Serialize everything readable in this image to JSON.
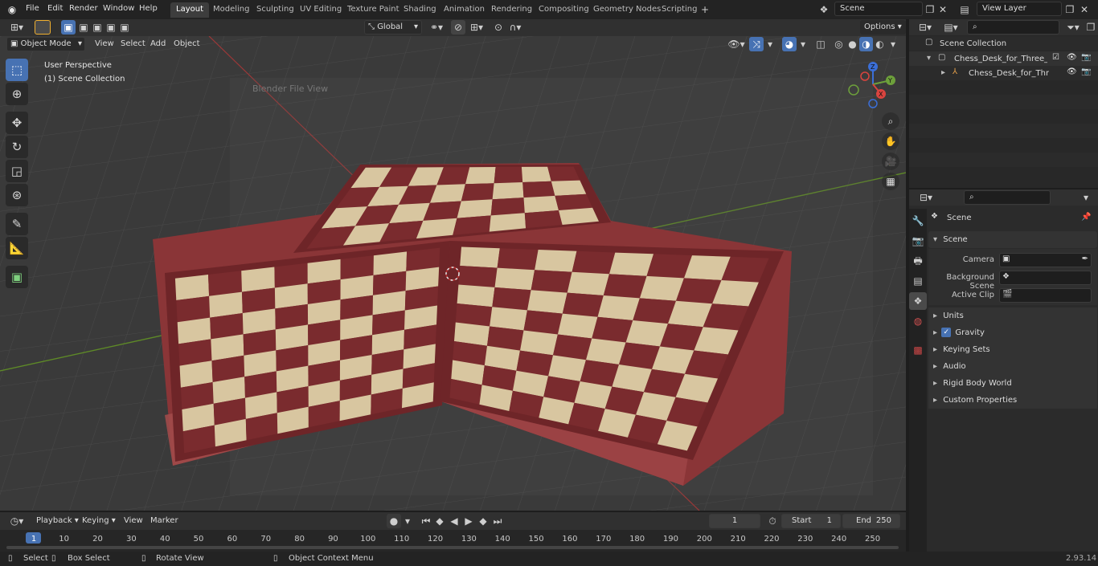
{
  "menu": {
    "file": "File",
    "edit": "Edit",
    "render": "Render",
    "window": "Window",
    "help": "Help"
  },
  "workspaces": [
    "Layout",
    "Modeling",
    "Sculpting",
    "UV Editing",
    "Texture Paint",
    "Shading",
    "Animation",
    "Rendering",
    "Compositing",
    "Geometry Nodes",
    "Scripting"
  ],
  "active_workspace": "Layout",
  "scene_name": "Scene",
  "view_layer": "View Layer",
  "viewport": {
    "mode": "Object Mode",
    "menus": [
      "View",
      "Select",
      "Add",
      "Object"
    ],
    "orientation": "Global",
    "options": "Options",
    "perspective": "User Perspective",
    "collection": "(1) Scene Collection",
    "ghost_title": "Blender File View",
    "axis_labels": {
      "x": "X",
      "y": "Y",
      "z": "Z"
    }
  },
  "outliner": {
    "root": "Scene Collection",
    "items": [
      {
        "label": "Chess_Desk_for_Three_Playe"
      },
      {
        "label": "Chess_Desk_for_Three_P"
      }
    ]
  },
  "properties": {
    "header": "Scene",
    "panel": "Scene",
    "camera_label": "Camera",
    "background_label": "Background Scene",
    "clip_label": "Active Clip",
    "sections": [
      "Units",
      "Gravity",
      "Keying Sets",
      "Audio",
      "Rigid Body World",
      "Custom Properties"
    ],
    "gravity_checked": true
  },
  "timeline": {
    "menus": [
      "Playback",
      "Keying",
      "View",
      "Marker"
    ],
    "current_frame": "1",
    "start_label": "Start",
    "start_value": "1",
    "end_label": "End",
    "end_value": "250",
    "ticks": [
      "1",
      "10",
      "20",
      "30",
      "40",
      "50",
      "60",
      "70",
      "80",
      "90",
      "100",
      "110",
      "120",
      "130",
      "140",
      "150",
      "160",
      "170",
      "180",
      "190",
      "200",
      "210",
      "220",
      "230",
      "240",
      "250"
    ]
  },
  "status": {
    "select": "Select",
    "box_select": "Box Select",
    "rotate": "Rotate View",
    "context": "Object Context Menu",
    "version": "2.93.14"
  },
  "colors": {
    "accent": "#4772b3",
    "board_dark": "#7a2b2e",
    "board_light": "#d8c6a0",
    "bg": "#3a3a3a"
  }
}
